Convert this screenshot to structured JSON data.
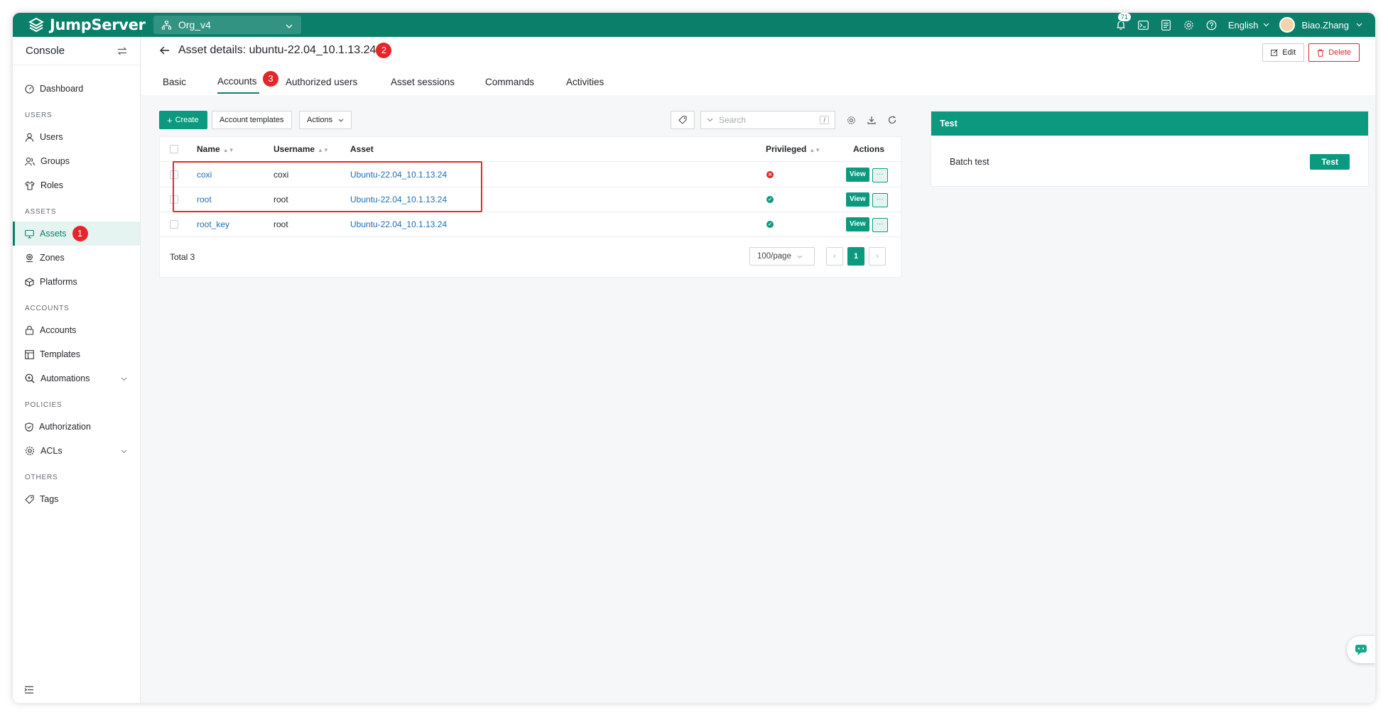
{
  "topbar": {
    "logo_text": "JumpServer",
    "org": "Org_v4",
    "notification_count": "71",
    "language": "English",
    "user": "Biao.Zhang",
    "brand_color": "#0b7f6a"
  },
  "sidebar": {
    "title": "Console",
    "sections": {
      "users": "USERS",
      "assets": "ASSETS",
      "accounts": "ACCOUNTS",
      "policies": "POLICIES",
      "others": "OTHERS"
    },
    "items": {
      "dashboard": "Dashboard",
      "users": "Users",
      "groups": "Groups",
      "roles": "Roles",
      "assets": "Assets",
      "zones": "Zones",
      "platforms": "Platforms",
      "accounts": "Accounts",
      "templates": "Templates",
      "automations": "Automations",
      "authorization": "Authorization",
      "acls": "ACLs",
      "tags": "Tags"
    }
  },
  "steps": {
    "one": "1",
    "two": "2",
    "three": "3"
  },
  "header": {
    "title": "Asset details: ubuntu-22.04_10.1.13.24",
    "edit": "Edit",
    "delete": "Delete",
    "tabs": {
      "basic": "Basic",
      "accounts": "Accounts",
      "authorized_users": "Authorized users",
      "asset_sessions": "Asset sessions",
      "commands": "Commands",
      "activities": "Activities"
    }
  },
  "toolbar": {
    "create": "Create",
    "account_templates": "Account templates",
    "actions": "Actions",
    "search_placeholder": "Search",
    "search_kbd": "/"
  },
  "table": {
    "headers": {
      "name": "Name",
      "username": "Username",
      "asset": "Asset",
      "privileged": "Privileged",
      "actions": "Actions"
    },
    "view_label": "View",
    "more_label": "···",
    "rows": [
      {
        "name": "coxi",
        "username": "coxi",
        "asset": "Ubuntu-22.04_10.1.13.24",
        "privileged": "no"
      },
      {
        "name": "root",
        "username": "root",
        "asset": "Ubuntu-22.04_10.1.13.24",
        "privileged": "yes"
      },
      {
        "name": "root_key",
        "username": "root",
        "asset": "Ubuntu-22.04_10.1.13.24",
        "privileged": "yes"
      }
    ],
    "total": "Total 3",
    "page_size": "100/page",
    "current_page": "1"
  },
  "test_panel": {
    "title": "Test",
    "row_label": "Batch test",
    "button": "Test"
  }
}
